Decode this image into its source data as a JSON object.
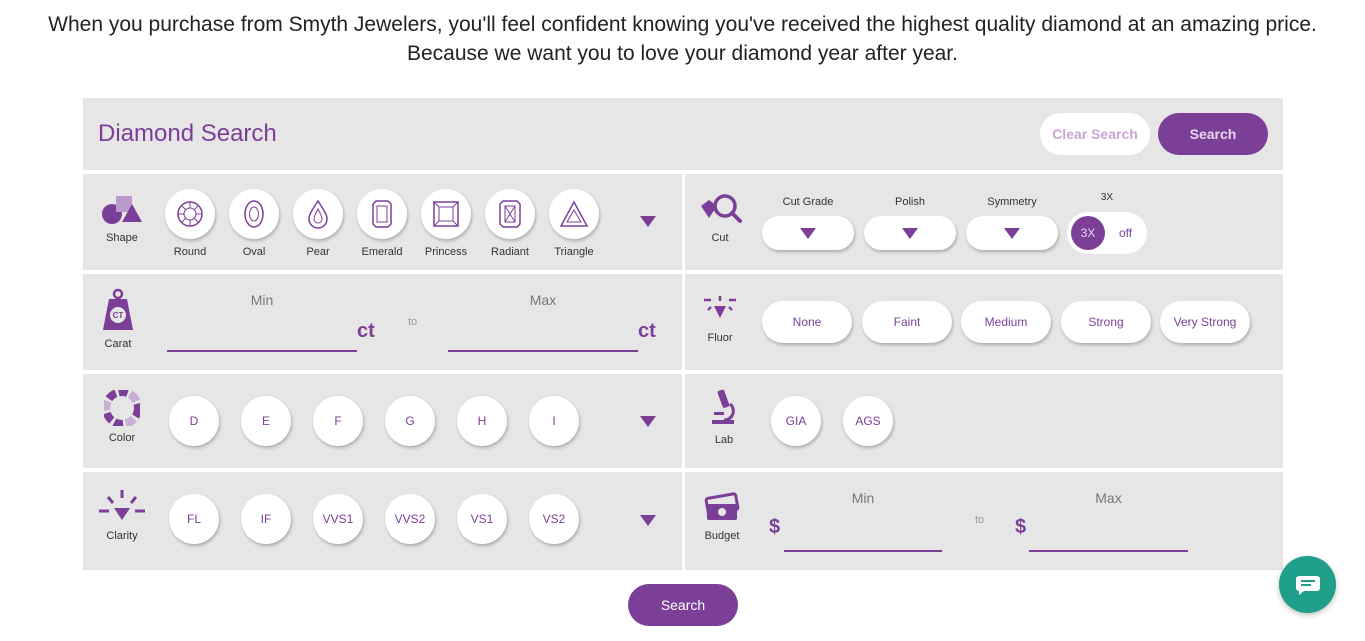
{
  "intro": {
    "line1": "When you purchase from Smyth Jewelers, you'll feel confident knowing you've received the highest quality diamond at an amazing price.",
    "line2": "Because we want you to love your diamond year after year."
  },
  "panel": {
    "title": "Diamond Search",
    "clear_label": "Clear Search",
    "search_label": "Search"
  },
  "shape": {
    "label": "Shape",
    "items": [
      {
        "label": "Round",
        "icon": "round-cut-icon"
      },
      {
        "label": "Oval",
        "icon": "oval-cut-icon"
      },
      {
        "label": "Pear",
        "icon": "pear-cut-icon"
      },
      {
        "label": "Emerald",
        "icon": "emerald-cut-icon"
      },
      {
        "label": "Princess",
        "icon": "princess-cut-icon"
      },
      {
        "label": "Radiant",
        "icon": "radiant-cut-icon"
      },
      {
        "label": "Triangle",
        "icon": "triangle-cut-icon"
      }
    ]
  },
  "cut": {
    "label": "Cut",
    "cut_grade_label": "Cut Grade",
    "polish_label": "Polish",
    "symmetry_label": "Symmetry",
    "triple_label": "3X",
    "toggle_on": "3X",
    "toggle_off": "off"
  },
  "carat": {
    "label": "Carat",
    "badge": "CT",
    "min_label": "Min",
    "max_label": "Max",
    "to_label": "to",
    "unit": "ct"
  },
  "fluor": {
    "label": "Fluor",
    "options": [
      "None",
      "Faint",
      "Medium",
      "Strong",
      "Very Strong"
    ]
  },
  "color": {
    "label": "Color",
    "options": [
      "D",
      "E",
      "F",
      "G",
      "H",
      "I"
    ]
  },
  "lab": {
    "label": "Lab",
    "options": [
      "GIA",
      "AGS"
    ]
  },
  "clarity": {
    "label": "Clarity",
    "options": [
      "FL",
      "IF",
      "VVS1",
      "VVS2",
      "VS1",
      "VS2"
    ]
  },
  "budget": {
    "label": "Budget",
    "min_label": "Min",
    "max_label": "Max",
    "to_label": "to",
    "currency": "$"
  },
  "bottom": {
    "search_label": "Search"
  },
  "colors": {
    "accent": "#7b3f98",
    "panel_bg": "#e6e6e6",
    "chat": "#1f9e8a"
  }
}
